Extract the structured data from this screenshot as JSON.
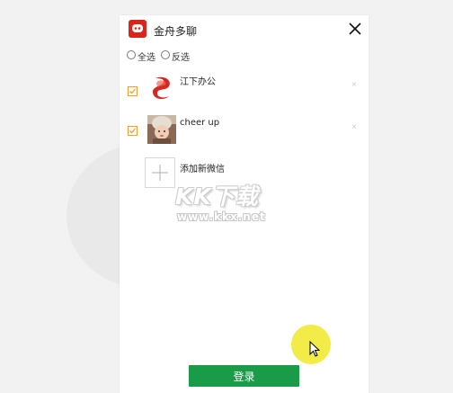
{
  "app": {
    "title": "金舟多聊",
    "logo_icon": "chat-bubble-icon",
    "brand_color": "#d9261c"
  },
  "selection": {
    "select_all_label": "全选",
    "invert_label": "反选"
  },
  "accounts": [
    {
      "name": "江下办公",
      "checked": true,
      "avatar": "jiangxia-logo"
    },
    {
      "name": "cheer up",
      "checked": true,
      "avatar": "baby-photo"
    }
  ],
  "add_account": {
    "label": "添加新微信"
  },
  "remove_symbol": "×",
  "watermark": {
    "title": "KK下载",
    "url": "www.kkx.net"
  },
  "login": {
    "label": "登录",
    "color": "#1a9b48"
  },
  "checkbox_color": "#f0a030"
}
